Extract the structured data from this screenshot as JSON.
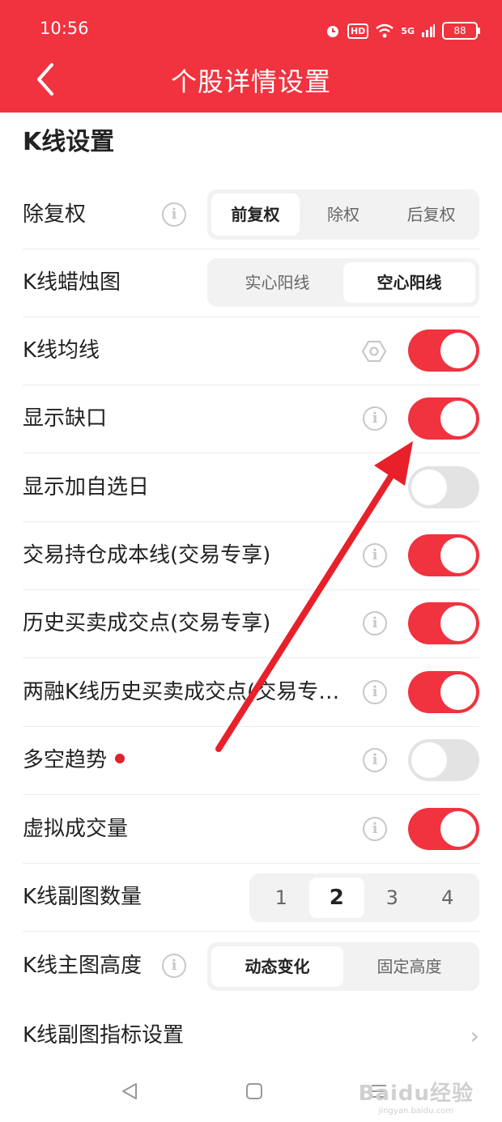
{
  "status_bar": {
    "time": "10:56",
    "hd": "HD",
    "network": "5G",
    "battery": "88"
  },
  "header": {
    "title": "个股详情设置"
  },
  "section_title": "K线设置",
  "rows": {
    "adjust": {
      "label": "除复权",
      "options": [
        "前复权",
        "除权",
        "后复权"
      ],
      "selected": "前复权"
    },
    "candle": {
      "label": "K线蜡烛图",
      "options": [
        "实心阳线",
        "空心阳线"
      ],
      "selected": "空心阳线"
    },
    "ma": {
      "label": "K线均线",
      "enabled": true
    },
    "gap": {
      "label": "显示缺口",
      "enabled": true
    },
    "watch_day": {
      "label": "显示加自选日",
      "enabled": false
    },
    "cost_line": {
      "label": "交易持仓成本线(交易专享)",
      "enabled": true
    },
    "history_trades": {
      "label": "历史买卖成交点(交易专享)",
      "enabled": true
    },
    "margin_trades": {
      "label": "两融K线历史买卖成交点(交易专…",
      "enabled": true
    },
    "trend": {
      "label": "多空趋势",
      "enabled": false,
      "badge_color": "#e0222f"
    },
    "virtual_volume": {
      "label": "虚拟成交量",
      "enabled": true
    },
    "sub_count": {
      "label": "K线副图数量",
      "options": [
        "1",
        "2",
        "3",
        "4"
      ],
      "selected": "2"
    },
    "main_height": {
      "label": "K线主图高度",
      "options": [
        "动态变化",
        "固定高度"
      ],
      "selected": "动态变化"
    },
    "sub_indicator": {
      "label": "K线副图指标设置"
    }
  },
  "watermark": {
    "text": "Baidu经验",
    "sub": "jingyan.baidu.com"
  },
  "colors": {
    "accent": "#f0333f",
    "toggle_off": "#e3e3e3"
  },
  "icons": {
    "back": "chevron-left-icon",
    "info": "info-icon",
    "settings": "hexagon-gear-icon",
    "row_arrow": "chevron-right-icon"
  }
}
